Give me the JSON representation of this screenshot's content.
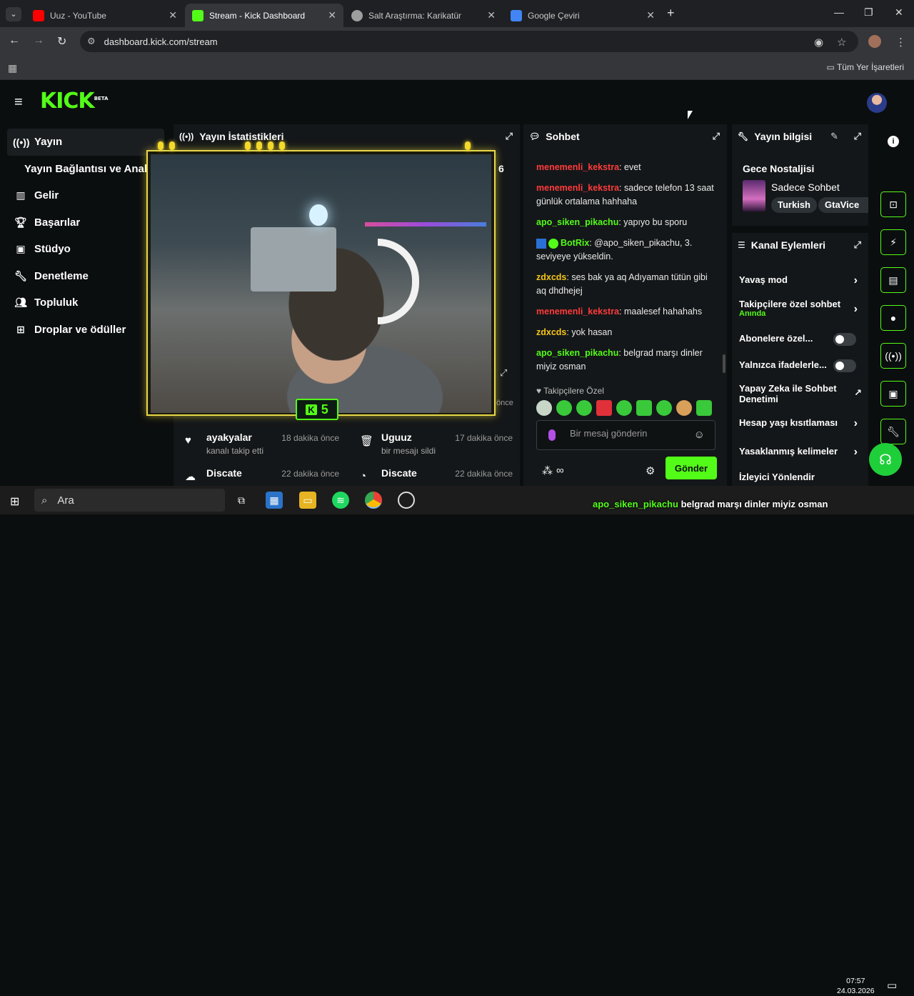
{
  "browser": {
    "tabs": [
      {
        "title": "Uuz - YouTube",
        "color": "#ff0000"
      },
      {
        "title": "Stream - Kick Dashboard",
        "color": "#53fc18"
      },
      {
        "title": "Salt Araştırma: Karikatür",
        "color": "#9e9e9e"
      },
      {
        "title": "Google Çeviri",
        "color": "#4285f4"
      }
    ],
    "url": "dashboard.kick.com/stream",
    "bookmarks_label": "Tüm Yer İşaretleri"
  },
  "app": {
    "logo": "KICK",
    "logo_badge": "BETA",
    "accent": "#53fc18"
  },
  "sidebar": {
    "items": [
      {
        "label": "Yayın",
        "icon": "broadcast-icon"
      },
      {
        "label": "Yayın Bağlantısı ve Anahtarı",
        "icon": ""
      },
      {
        "label": "Gelir",
        "icon": "chart-icon"
      },
      {
        "label": "Başarılar",
        "icon": "trophy-icon"
      },
      {
        "label": "Stüdyo",
        "icon": "studio-icon"
      },
      {
        "label": "Denetleme",
        "icon": "wrench-icon"
      },
      {
        "label": "Topluluk",
        "icon": "users-icon"
      },
      {
        "label": "Droplar ve ödüller",
        "icon": "gift-icon"
      }
    ]
  },
  "stats": {
    "title": "Yayın İstatistikleri",
    "side_number": "6",
    "side_time": "önce",
    "overlay_badge": "5",
    "feed": [
      {
        "name": "ayakyalar",
        "sub": "kanalı takip etti",
        "time": "18 dakika önce"
      },
      {
        "name": "Uguuz",
        "sub": "bir mesajı sildi",
        "time": "17 dakika önce"
      },
      {
        "name": "Discate",
        "sub": "",
        "time": "22 dakika önce"
      },
      {
        "name": "Discate",
        "sub": "",
        "time": "22 dakika önce"
      }
    ]
  },
  "chat": {
    "title": "Sohbet",
    "messages": [
      {
        "user": "menemenli_kekstra",
        "color": "#ff3b3b",
        "text": ": evet"
      },
      {
        "user": "menemenli_kekstra",
        "color": "#ff3b3b",
        "text": ": sadece telefon 13 saat günlük ortalama hahhaha"
      },
      {
        "user": "apo_siken_pikachu",
        "color": "#53fc18",
        "text": ": yapıyo bu sporu"
      },
      {
        "user": "BotRix",
        "color": "#53fc18",
        "text": ": @apo_siken_pikachu, 3. seviyeye yükseldin."
      },
      {
        "user": "zdxcds",
        "color": "#f5c518",
        "text": ": ses bak ya aq Adıyaman tütün gibi aq dhdhejej"
      },
      {
        "user": "menemenli_kekstra",
        "color": "#ff3b3b",
        "text": ": maalesef hahahahs"
      },
      {
        "user": "zdxcds",
        "color": "#f5c518",
        "text": ": yok hasan"
      },
      {
        "user": "apo_siken_pikachu",
        "color": "#53fc18",
        "text": ": belgrad marşı dinler miyiz osman"
      }
    ],
    "follower_only": "Takipçilere Özel",
    "input_placeholder": "Bir mesaj gönderin",
    "send_label": "Gönder"
  },
  "info": {
    "title": "Yayın bilgisi",
    "stream_title": "Gece Nostaljisi",
    "category": "Sadece Sohbet",
    "tags": [
      "Turkish",
      "GtaVice"
    ]
  },
  "actions": {
    "title": "Kanal Eylemleri",
    "rows": [
      {
        "label": "Yavaş mod",
        "extra": "",
        "control": "chevron"
      },
      {
        "label": "Takipçilere özel sohbet",
        "extra": "Anında",
        "control": "chevron"
      },
      {
        "label": "Abonelere özel...",
        "extra": "",
        "control": "toggle"
      },
      {
        "label": "Yalnızca ifadelerle...",
        "extra": "",
        "control": "toggle"
      },
      {
        "label": "Yapay Zeka ile Sohbet Denetimi",
        "extra": "",
        "control": "external"
      },
      {
        "label": "Hesap yaşı kısıtlaması",
        "extra": "",
        "control": "chevron"
      },
      {
        "label": "Yasaklanmış kelimeler",
        "extra": "",
        "control": "chevron"
      },
      {
        "label": "İzleyici Yönlendir",
        "extra": "",
        "control": "none"
      }
    ]
  },
  "taskbar": {
    "search_label": "Ara",
    "ticker_user": "apo_siken_pikachu",
    "ticker_text": "belgrad marşı dinler miyiz osman",
    "time": "07:57",
    "date": "24.03.2026"
  }
}
